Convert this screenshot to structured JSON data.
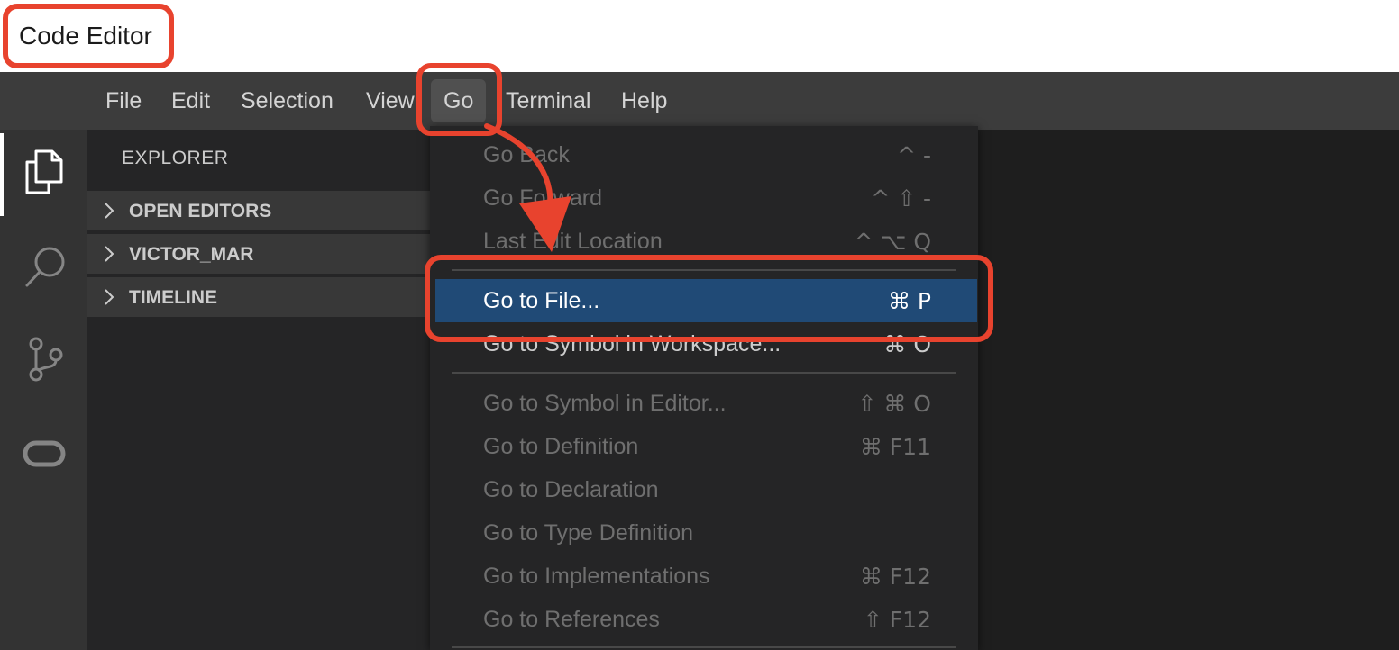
{
  "app": {
    "title": "Code Editor"
  },
  "menubar": {
    "items": [
      {
        "label": "File"
      },
      {
        "label": "Edit"
      },
      {
        "label": "Selection"
      },
      {
        "label": "View"
      },
      {
        "label": "Go"
      },
      {
        "label": "Terminal"
      },
      {
        "label": "Help"
      }
    ],
    "active": "Go"
  },
  "activitybar": {
    "icons": [
      "explorer-icon",
      "search-icon",
      "source-control-icon",
      "remote-icon"
    ]
  },
  "sidebar": {
    "title": "EXPLORER",
    "sections": [
      {
        "label": "OPEN EDITORS"
      },
      {
        "label": "VICTOR_MAR"
      },
      {
        "label": "TIMELINE"
      }
    ]
  },
  "go_menu": {
    "items": [
      {
        "label": "Go Back",
        "shortcut": "^ -"
      },
      {
        "label": "Go Forward",
        "shortcut": "^ ⇧ -"
      },
      {
        "label": "Last Edit Location",
        "shortcut": "^ ⌥ Q"
      },
      {
        "label": "Go to File...",
        "shortcut": "⌘ P",
        "state": "highlighted"
      },
      {
        "label": "Go to Symbol in Workspace...",
        "shortcut": "⌘ O"
      },
      {
        "label": "Go to Symbol in Editor...",
        "shortcut": "⇧ ⌘ O"
      },
      {
        "label": "Go to Definition",
        "shortcut": "⌘ F11"
      },
      {
        "label": "Go to Declaration",
        "shortcut": ""
      },
      {
        "label": "Go to Type Definition",
        "shortcut": ""
      },
      {
        "label": "Go to Implementations",
        "shortcut": "⌘ F12"
      },
      {
        "label": "Go to References",
        "shortcut": "⇧ F12"
      }
    ]
  },
  "colors": {
    "callout": "#e8432e",
    "menu_highlight": "#204a76",
    "menubar": "#3c3c3c",
    "sidebar": "#252526",
    "editor": "#1e1e1e"
  }
}
